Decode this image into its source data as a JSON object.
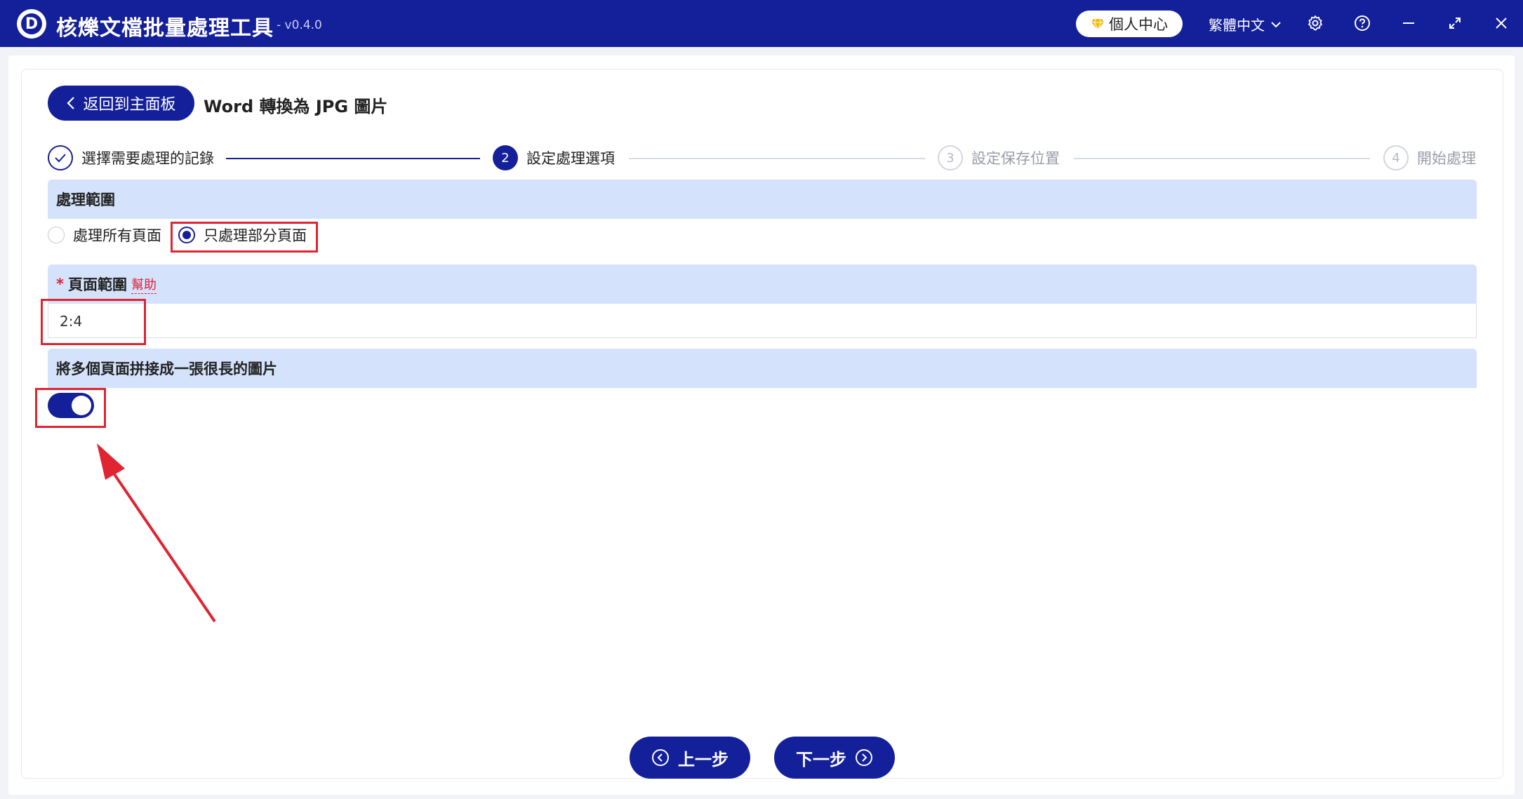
{
  "app": {
    "logo_letter": "D",
    "title": "核爍文檔批量處理工具",
    "version": "- v0.4.0",
    "personal_center": "個人中心",
    "language": "繁體中文"
  },
  "header": {
    "back_label": "返回到主面板",
    "page_title": "Word 轉換為 JPG 圖片"
  },
  "steps": [
    {
      "number": "",
      "label": "選擇需要處理的記錄",
      "state": "done"
    },
    {
      "number": "2",
      "label": "設定處理選項",
      "state": "active"
    },
    {
      "number": "3",
      "label": "設定保存位置",
      "state": "todo"
    },
    {
      "number": "4",
      "label": "開始處理",
      "state": "todo"
    }
  ],
  "range_section": {
    "title": "處理範圍",
    "options": [
      {
        "label": "處理所有頁面",
        "checked": false
      },
      {
        "label": "只處理部分頁面",
        "checked": true
      }
    ]
  },
  "page_range": {
    "required_mark": "*",
    "title": "頁面範圍",
    "help": "幫助",
    "value": "2:4"
  },
  "merge_section": {
    "title": "將多個頁面拼接成一張很長的圖片",
    "enabled": true
  },
  "footer": {
    "prev_label": "上一步",
    "next_label": "下一步"
  },
  "colors": {
    "primary": "#141f9a",
    "section_bg": "#d5e2fb",
    "highlight": "#e02432"
  }
}
